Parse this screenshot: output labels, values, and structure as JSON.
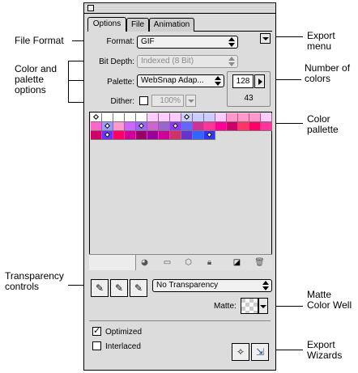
{
  "tabs": [
    {
      "label": "Options",
      "active": true
    },
    {
      "label": "File",
      "active": false
    },
    {
      "label": "Animation",
      "active": false
    }
  ],
  "format": {
    "label": "Format:",
    "value": "GIF"
  },
  "bit_depth": {
    "label": "Bit Depth:",
    "value": "Indexed (8 Bit)"
  },
  "palette": {
    "label": "Palette:",
    "value": "WebSnap Adap..."
  },
  "dither": {
    "label": "Dither:",
    "value": "100%"
  },
  "number_of_colors": {
    "value": "128",
    "count": "43"
  },
  "transparency": {
    "value": "No Transparency"
  },
  "matte": {
    "label": "Matte:"
  },
  "optimized": {
    "label": "Optimized",
    "checked": true
  },
  "interlaced": {
    "label": "Interlaced",
    "checked": false
  },
  "callouts": {
    "file_format": "File Format",
    "color_palette_options": "Color and palette options",
    "transparency_controls": "Transparency controls",
    "export_menu": "Export menu",
    "number_of_colors": "Number of colors",
    "color_pallette": "Color pallette",
    "matte_color_well": "Matte Color Well",
    "export_wizards": "Export Wizards"
  },
  "swatch_rows": [
    [
      "#ffffff",
      "#ffffff",
      "#ffffff",
      "#ffffff",
      "#ffffff",
      "#ffccff",
      "#ffccff",
      "#ffccff",
      "#ccccff",
      "#ccccff",
      "#ccccff",
      "#ffccff",
      "#ff99cc",
      "#ff99cc",
      "#ff99cc",
      "#ffccff"
    ],
    [
      "#ff66cc",
      "#9999ff",
      "#ff99cc",
      "#cc66ff",
      "#9966ff",
      "#cc66cc",
      "#9966cc",
      "#9933ff",
      "#6666ff",
      "#cc3399",
      "#ff3399",
      "#ff0099",
      "#cc0066",
      "#ff3366",
      "#ff0066",
      "#ff3399"
    ],
    [
      "#cc0066",
      "#6633ff",
      "#ff0066",
      "#cc0099",
      "#990066",
      "#990099",
      "#cc0099",
      "#cc3366",
      "#6633cc",
      "#3366ff",
      "#3333ff"
    ]
  ],
  "swatch_marks": [
    [
      0,
      0
    ],
    [
      0,
      8
    ],
    [
      1,
      1
    ],
    [
      1,
      4
    ],
    [
      1,
      7
    ],
    [
      2,
      1
    ],
    [
      2,
      10
    ]
  ]
}
